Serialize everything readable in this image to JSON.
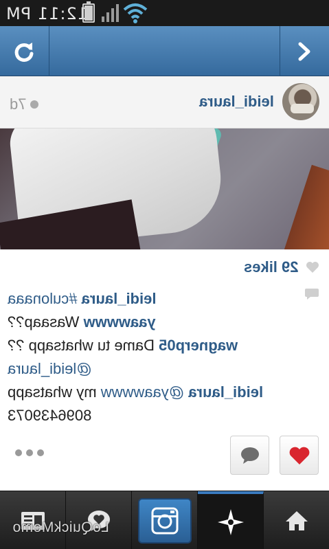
{
  "status_bar": {
    "time": "12:11 PM",
    "battery_level": 0.85,
    "icons": [
      "battery-icon",
      "signal-icon",
      "wifi-icon"
    ]
  },
  "header": {
    "left_icon": "refresh-icon",
    "right_icon": "chevron-right-icon",
    "color": "#356a9d"
  },
  "post": {
    "username": "leidi_laura",
    "age": "7d",
    "likes": "29 likes",
    "comments": [
      {
        "user": "leidi_laura",
        "text": "#culonaaa"
      },
      {
        "user": "yaawwww",
        "text": "Wasaap??"
      },
      {
        "user": "wagnerp05",
        "text": "Dame tu whatsapp ??"
      },
      {
        "user": "",
        "text": "@leidi_laura"
      },
      {
        "user": "leidi_laura",
        "mention": "@yaawwww",
        "text": "my whatsapp"
      },
      {
        "user": "",
        "text": "8096439073"
      }
    ]
  },
  "actions": {
    "more_icon": "more-dots-icon",
    "comment_icon": "comment-bubble-icon",
    "like_icon": "heart-icon"
  },
  "tabbar": {
    "tabs": [
      "feed-icon",
      "news-heart-icon",
      "camera-icon",
      "explore-star-icon",
      "home-icon"
    ],
    "active_index": 3,
    "overlay": "LoQuickMemo"
  }
}
